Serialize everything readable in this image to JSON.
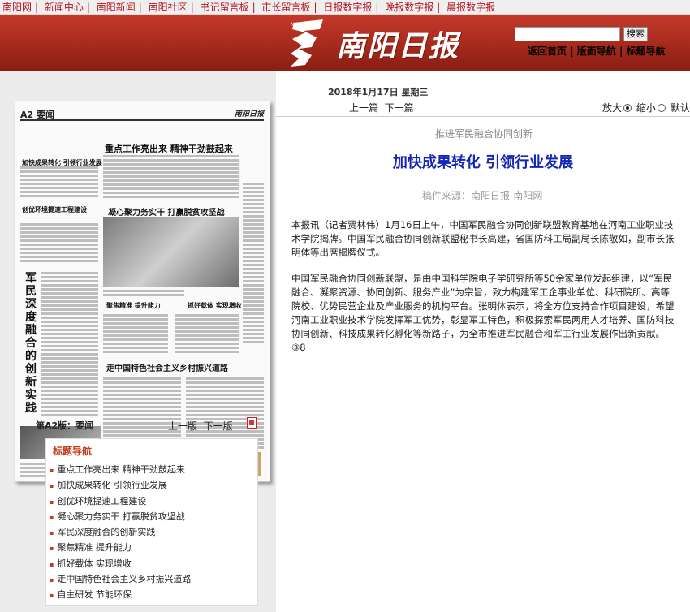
{
  "topnav": {
    "items": [
      "南阳网",
      "新闻中心",
      "南阳新闻",
      "南阳社区",
      "书记留言板",
      "市长留言板",
      "日报数字报",
      "晚报数字报",
      "晨报数字报"
    ]
  },
  "banner": {
    "logo_text": "南阳日报",
    "logo_small": "N·Y DAILY",
    "search_button": "搜索",
    "search_placeholder": "",
    "links": [
      "返回首页",
      "版面导航",
      "标题导航"
    ]
  },
  "paper_preview": {
    "page_label": "A2 要闻",
    "brand": "南阳日报",
    "headlines": [
      "重点工作亮出来 精神干劲鼓起来",
      "凝心聚力务实干 打赢脱贫攻坚战",
      "走中国特色社会主义乡村振兴道路",
      "聚焦精准 提升能力",
      "抓好载体 实现增收",
      "加快成果转化 引领行业发展",
      "创优环境提速工程建设"
    ],
    "vertical_title": "军民深度融合的创新实践"
  },
  "edition": {
    "label": "第A2版：要闻",
    "prev": "上一版",
    "next": "下一版"
  },
  "title_nav": {
    "heading": "标题导航",
    "items": [
      "重点工作亮出来 精神干劲鼓起来",
      "加快成果转化 引领行业发展",
      "创优环境提速工程建设",
      "凝心聚力务实干 打赢脱贫攻坚战",
      "军民深度融合的创新实践",
      "聚焦精准 提升能力",
      "抓好载体 实现增收",
      "走中国特色社会主义乡村振兴道路",
      "自主研发 节能环保"
    ]
  },
  "article": {
    "date": "2018年1月17日 星期三",
    "prev": "上一篇",
    "next": "下一篇",
    "zoom_in": "放大",
    "zoom_out": "缩小",
    "zoom_default": "默认",
    "kicker": "推进军民融合协同创新",
    "title": "加快成果转化 引领行业发展",
    "source": "稿件来源：南阳日报-南阳网",
    "paragraphs": [
      "本报讯（记者贾林伟）1月16日上午，中国军民融合协同创新联盟教育基地在河南工业职业技术学院揭牌。中国军民融合协同创新联盟秘书长高建，省国防科工局副局长陈敬如，副市长张明体等出席揭牌仪式。",
      "中国军民融合协同创新联盟，是由中国科学院电子学研究所等50余家单位发起组建，以“军民融合、凝聚资源、协同创新、服务产业”为宗旨，致力构建军工企事业单位、科研院所、高等院校、优势民营企业及产业服务的机构平台。张明体表示，将全方位支持合作项目建设，希望河南工业职业技术学院发挥军工优势，彰显军工特色，积极探索军民两用人才培养、国防科技协同创新、科技成果转化孵化等新路子，为全市推进军民融合和军工行业发展作出新贡献。③8"
    ]
  },
  "colors": {
    "nav_red": "#b5141c",
    "banner_top": "#c63a2a",
    "banner_bottom": "#8a1d12",
    "title_blue": "#1525b5",
    "tnav_accent": "#c23b1a"
  }
}
